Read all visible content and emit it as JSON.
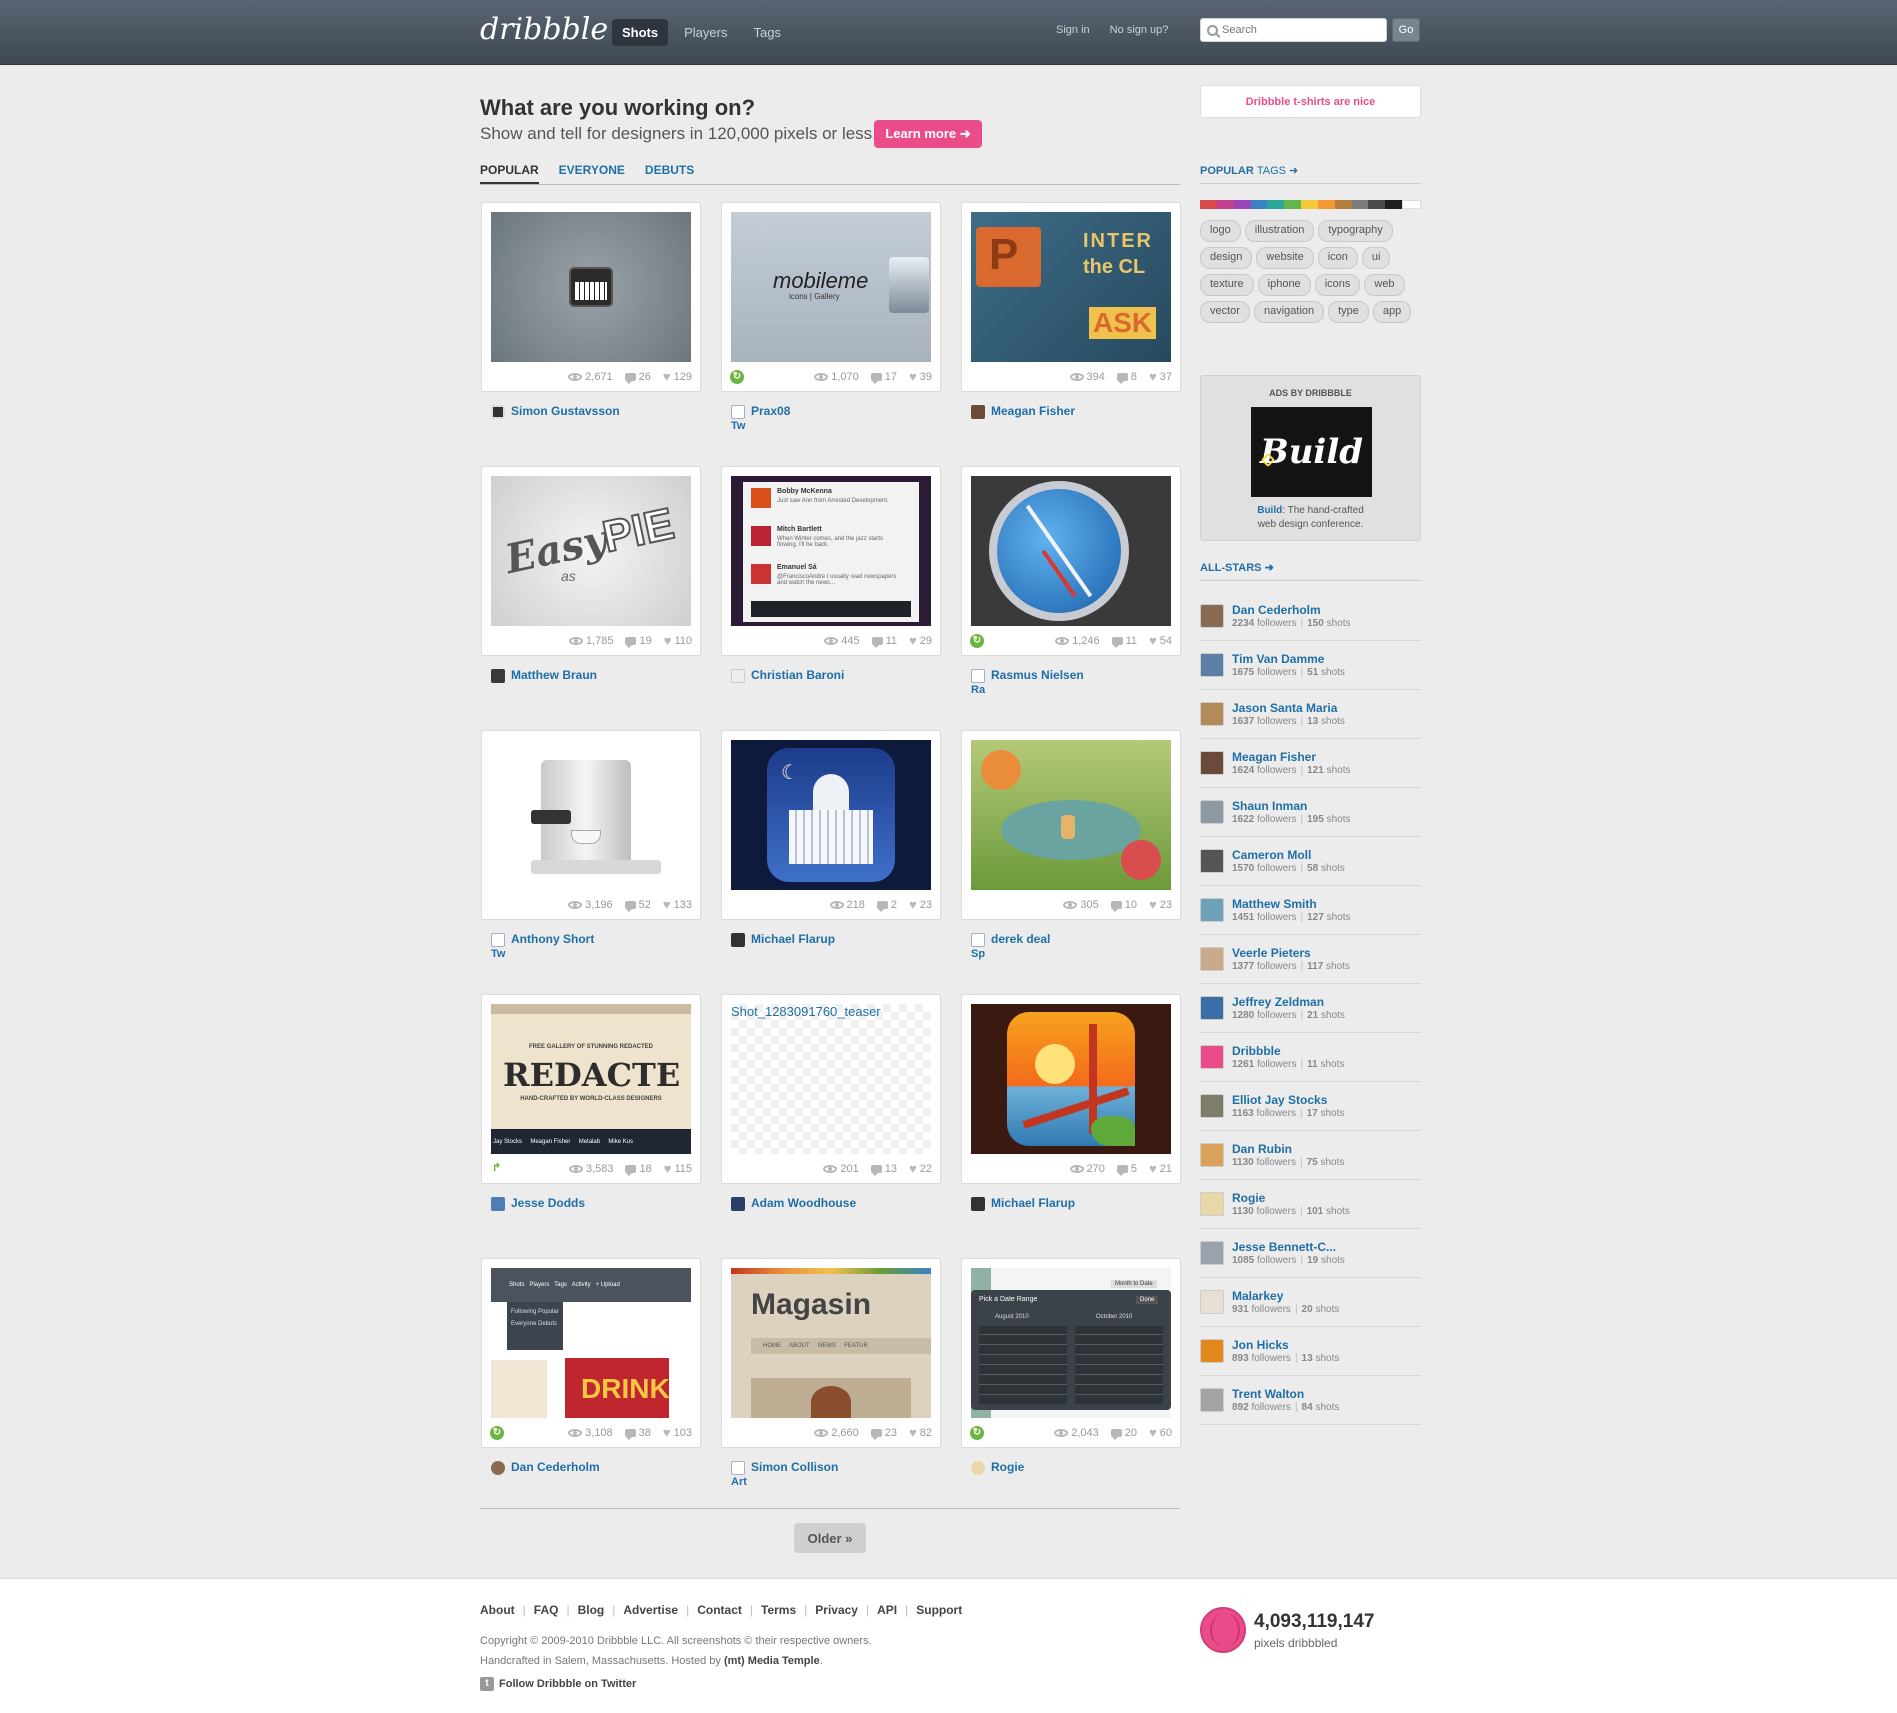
{
  "header": {
    "logo": "dribbble",
    "nav": [
      "Shots",
      "Players",
      "Tags"
    ],
    "sign_in": "Sign in",
    "sign_up": "No sign up?",
    "search_placeholder": "Search",
    "go": "Go"
  },
  "intro": {
    "title": "What are you working on?",
    "subtitle": "Show and tell for designers in 120,000 pixels or less.",
    "learn_more": "Learn more ➜"
  },
  "tabs": [
    "POPULAR",
    "EVERYONE",
    "DEBUTS"
  ],
  "shots": [
    {
      "views": "2,671",
      "comments": "26",
      "likes": "129",
      "player": "Simon Gustavsson",
      "rebound": false,
      "extra": ""
    },
    {
      "views": "1,070",
      "comments": "17",
      "likes": "39",
      "player": "Prax08",
      "rebound": true,
      "extra": "Tw"
    },
    {
      "views": "394",
      "comments": "8",
      "likes": "37",
      "player": "Meagan Fisher",
      "rebound": false,
      "extra": ""
    },
    {
      "views": "1,785",
      "comments": "19",
      "likes": "110",
      "player": "Matthew Braun",
      "rebound": false,
      "extra": ""
    },
    {
      "views": "445",
      "comments": "11",
      "likes": "29",
      "player": "Christian Baroni",
      "rebound": false,
      "extra": ""
    },
    {
      "views": "1,246",
      "comments": "11",
      "likes": "54",
      "player": "Rasmus Nielsen",
      "rebound": true,
      "extra": "Ra"
    },
    {
      "views": "3,196",
      "comments": "52",
      "likes": "133",
      "player": "Anthony Short",
      "rebound": false,
      "extra": "Tw"
    },
    {
      "views": "218",
      "comments": "2",
      "likes": "23",
      "player": "Michael Flarup",
      "rebound": false,
      "extra": ""
    },
    {
      "views": "305",
      "comments": "10",
      "likes": "23",
      "player": "derek deal",
      "rebound": false,
      "extra": "Sp"
    },
    {
      "views": "3,583",
      "comments": "18",
      "likes": "115",
      "player": "Jesse Dodds",
      "rebound": false,
      "extra": ""
    },
    {
      "views": "201",
      "comments": "13",
      "likes": "22",
      "player": "Adam Woodhouse",
      "rebound": false,
      "extra": "",
      "broken_alt": "Shot_1283091760_teaser"
    },
    {
      "views": "270",
      "comments": "5",
      "likes": "21",
      "player": "Michael Flarup",
      "rebound": false,
      "extra": ""
    },
    {
      "views": "3,108",
      "comments": "38",
      "likes": "103",
      "player": "Dan Cederholm",
      "rebound": true,
      "extra": ""
    },
    {
      "views": "2,660",
      "comments": "23",
      "likes": "82",
      "player": "Simon Collison",
      "rebound": false,
      "extra": "Art"
    },
    {
      "views": "2,043",
      "comments": "20",
      "likes": "60",
      "player": "Rogie",
      "rebound": true,
      "extra": ""
    }
  ],
  "shot_images": {
    "mobileme": "mobileme",
    "mobileme_sub": "icons | Gallery",
    "inter": "INTER",
    "the_cl": "the CL",
    "ask": "ASK",
    "easy": "Easy",
    "as": "as",
    "pie": "PIE",
    "tw1_name": "Bobby McKenna",
    "tw1_text": "Just saw Ann from Arrested Development.",
    "tw2_name": "Mitch Bartlett",
    "tw2_text": "When Winter comes, and the jazz starts flowing, I'll be back.",
    "tw3_name": "Emanuel Sá",
    "tw3_text": "@FranciscoAndre I usually read newspapers and watch the news...",
    "redacted_top": "FREE GALLERY OF STUNNING REDACTED",
    "redacted": "REDACTE",
    "redacted_sub": "HAND-CRAFTED BY WORLD-CLASS DESIGNERS",
    "redacted_names": "Jay Stocks     Meagan Fisher     Metalab     Mike Kus",
    "dd_nav": "Shots   Players   Tags   Activity   + Upload",
    "dd_items": "Following Popular Everyone Debuts",
    "drink": "DRINK",
    "magasin": "Magasin",
    "magasin_nav": "HOME     ABOUT     NEWS     FEATUR",
    "date_range": "Pick a Date Range",
    "month_to_date": "Month to Date",
    "done": "Done",
    "aug": "August 2010",
    "oct": "October 2010"
  },
  "pager": {
    "older": "Older »"
  },
  "sidebar": {
    "promo": "Dribbble t-shirts are nice",
    "popular_tags_heading": "POPULAR",
    "popular_tags_suffix": "TAGS ➜",
    "colors": [
      "#d94a4a",
      "#c33f8f",
      "#9a45b9",
      "#3b82c4",
      "#2aa79b",
      "#64b64b",
      "#f3c93b",
      "#f39a32",
      "#b57d3f",
      "#7b7b7b",
      "#4a4a4a",
      "#1f1f1f",
      "#ffffff"
    ],
    "tags": [
      "logo",
      "illustration",
      "typography",
      "design",
      "website",
      "icon",
      "ui",
      "texture",
      "iphone",
      "icons",
      "web",
      "vector",
      "navigation",
      "type",
      "app"
    ],
    "ads_label": "ADS BY DRIBBBLE",
    "ads_logo_text": "Build",
    "ads_link": "Build",
    "ads_text_1": ": The hand-crafted",
    "ads_text_2": "web design conference.",
    "allstars_heading": "ALL-STARS ➜",
    "allstars": [
      {
        "name": "Dan Cederholm",
        "followers": "2234",
        "shots": "150",
        "color": "#8a6b52"
      },
      {
        "name": "Tim Van Damme",
        "followers": "1675",
        "shots": "51",
        "color": "#5b7fa5"
      },
      {
        "name": "Jason Santa Maria",
        "followers": "1637",
        "shots": "13",
        "color": "#b38a5a"
      },
      {
        "name": "Meagan Fisher",
        "followers": "1624",
        "shots": "121",
        "color": "#6b4a3a"
      },
      {
        "name": "Shaun Inman",
        "followers": "1622",
        "shots": "195",
        "color": "#8d9aa6"
      },
      {
        "name": "Cameron Moll",
        "followers": "1570",
        "shots": "58",
        "color": "#555"
      },
      {
        "name": "Matthew Smith",
        "followers": "1451",
        "shots": "127",
        "color": "#6fa1b8"
      },
      {
        "name": "Veerle Pieters",
        "followers": "1377",
        "shots": "117",
        "color": "#c9a98a"
      },
      {
        "name": "Jeffrey Zeldman",
        "followers": "1280",
        "shots": "21",
        "color": "#3b6ea8"
      },
      {
        "name": "Dribbble",
        "followers": "1261",
        "shots": "11",
        "color": "#ea4c89"
      },
      {
        "name": "Elliot Jay Stocks",
        "followers": "1163",
        "shots": "17",
        "color": "#7d7d6a"
      },
      {
        "name": "Dan Rubin",
        "followers": "1130",
        "shots": "75",
        "color": "#d8a25a"
      },
      {
        "name": "Rogie",
        "followers": "1130",
        "shots": "101",
        "color": "#e8d7a8"
      },
      {
        "name": "Jesse Bennett-C...",
        "followers": "1085",
        "shots": "19",
        "color": "#9aa3ad"
      },
      {
        "name": "Malarkey",
        "followers": "931",
        "shots": "20",
        "color": "#e6e0d4"
      },
      {
        "name": "Jon Hicks",
        "followers": "893",
        "shots": "13",
        "color": "#e2861e"
      },
      {
        "name": "Trent Walton",
        "followers": "892",
        "shots": "84",
        "color": "#a3a3a3"
      }
    ],
    "followers_word": "followers",
    "shots_word": "shots"
  },
  "footer": {
    "links": [
      "About",
      "FAQ",
      "Blog",
      "Advertise",
      "Contact",
      "Terms",
      "Privacy",
      "API",
      "Support"
    ],
    "copyright": "Copyright © 2009-2010 Dribbble LLC. All screenshots © their respective owners.",
    "handcrafted_1": "Handcrafted in Salem, Massachusetts. Hosted by ",
    "host": "(mt) Media Temple",
    "handcrafted_2": ".",
    "twitter": "Follow Dribbble on Twitter",
    "pixels": "4,093,119,147",
    "pixels_label": "pixels dribbbled"
  }
}
